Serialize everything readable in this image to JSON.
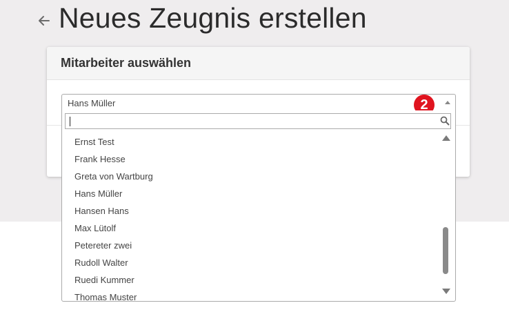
{
  "page": {
    "title": "Neues Zeugnis erstellen",
    "back_icon": "arrow-left-icon",
    "background_color": "#efedee"
  },
  "card": {
    "title": "Mitarbeiter auswählen"
  },
  "employee_select": {
    "selected_value": "Hans Müller",
    "badge": "2",
    "badge_color": "#e0141f",
    "search_value": "",
    "search_icon": "search-icon",
    "options": [
      "Ernst Test",
      "Frank Hesse",
      "Greta von Wartburg",
      "Hans Müller",
      "Hansen Hans",
      "Max Lütolf",
      "Petereter zwei",
      "Rudoll Walter",
      "Ruedi Kummer",
      "Thomas Muster"
    ]
  }
}
